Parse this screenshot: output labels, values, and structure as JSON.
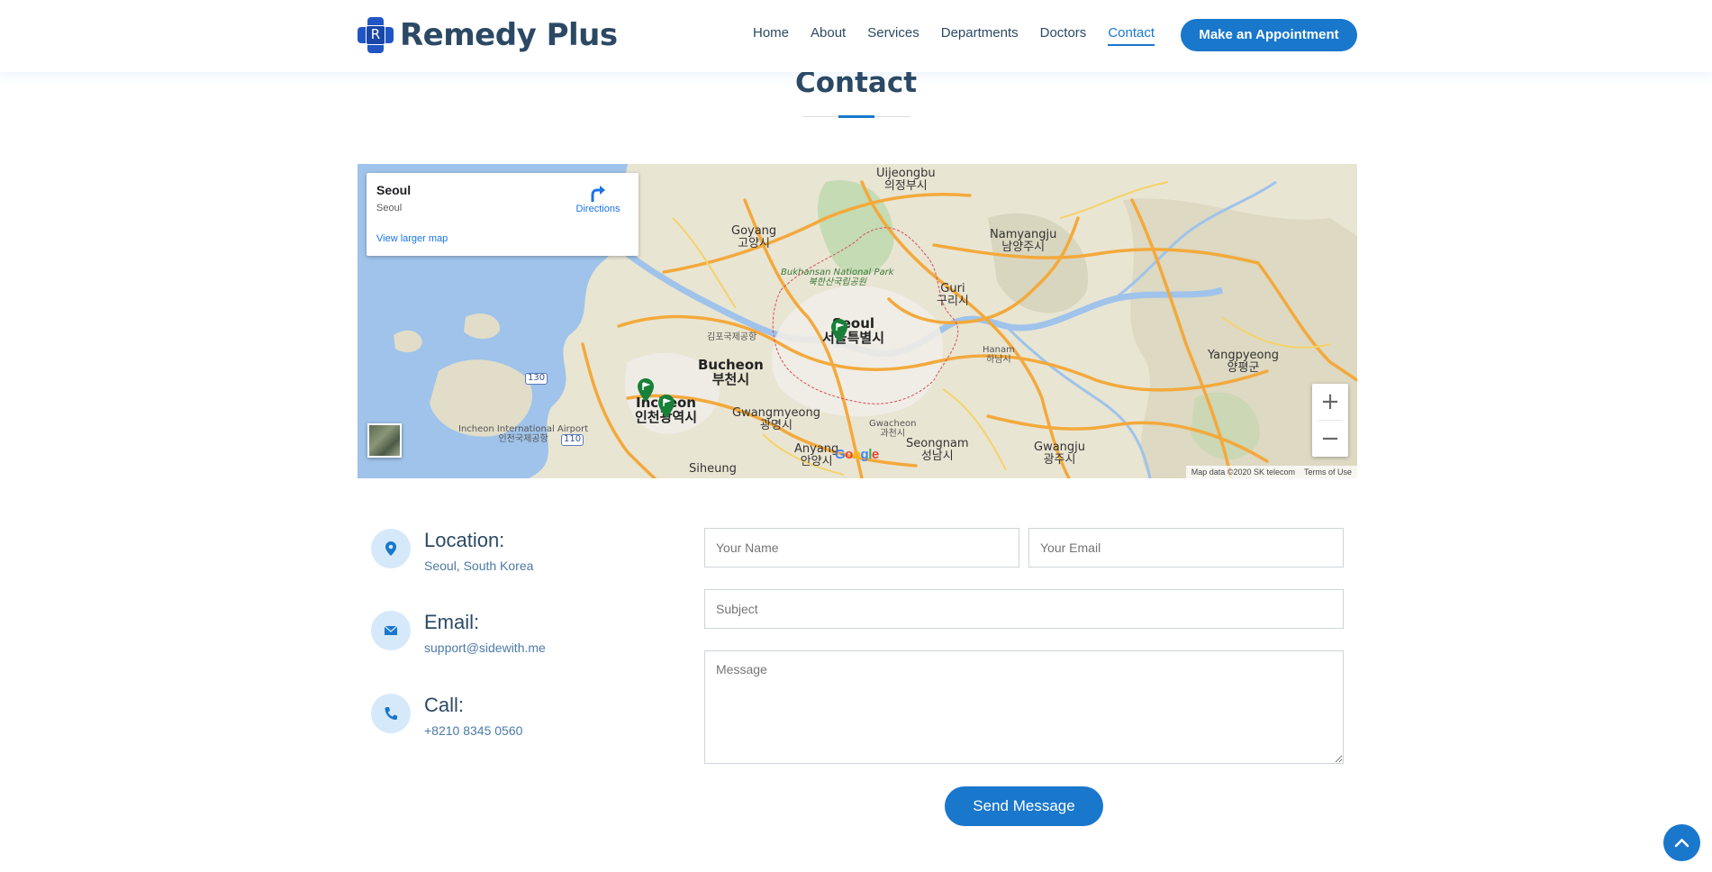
{
  "header": {
    "logo_letter": "R",
    "brand": "Remedy Plus",
    "nav": [
      {
        "label": "Home"
      },
      {
        "label": "About"
      },
      {
        "label": "Services"
      },
      {
        "label": "Departments"
      },
      {
        "label": "Doctors"
      },
      {
        "label": "Contact",
        "active": true
      }
    ],
    "cta_label": "Make an Appointment"
  },
  "section": {
    "title": "Contact"
  },
  "map": {
    "place_title": "Seoul",
    "place_subtitle": "Seoul",
    "directions_label": "Directions",
    "larger_map_label": "View larger map",
    "zoom_in": "+",
    "zoom_out": "−",
    "attribution": "Map data ©2020 SK telecom",
    "terms": "Terms of Use",
    "google_logo": "Google",
    "labels": {
      "uijeongbu_en": "Uijeongbu",
      "uijeongbu_ko": "의정부시",
      "goyang_en": "Goyang",
      "goyang_ko": "고양시",
      "namyangju_en": "Namyangju",
      "namyangju_ko": "남양주시",
      "bukhansan_en": "Bukhansan National Park",
      "bukhansan_ko": "북한산국립공원",
      "guri_en": "Guri",
      "guri_ko": "구리시",
      "seoul_en": "Seoul",
      "seoul_ko": "서울특별시",
      "gimpo_ko": "김포국제공항",
      "hanam_en": "Hanam",
      "hanam_ko": "하남시",
      "yangpyeong_en": "Yangpyeong",
      "yangpyeong_ko": "양평군",
      "bucheon_en": "Bucheon",
      "bucheon_ko": "부천시",
      "incheon_en": "Incheon",
      "incheon_ko": "인천광역시",
      "gwangmyeong_en": "Gwangmyeong",
      "gwangmyeong_ko": "광명시",
      "gwacheon_en": "Gwacheon",
      "gwacheon_ko": "과천시",
      "airport_en": "Incheon International Airport",
      "airport_ko": "인천국제공항",
      "anyang_en": "Anyang",
      "anyang_ko": "안양시",
      "seongnam_en": "Seongnam",
      "seongnam_ko": "성남시",
      "gwangju_en": "Gwangju",
      "gwangju_ko": "광주시",
      "siheung_en": "Siheung",
      "route_130": "130",
      "route_110": "110"
    }
  },
  "contact_info": [
    {
      "heading": "Location:",
      "value": "Seoul, South Korea",
      "icon": "map-pin-icon"
    },
    {
      "heading": "Email:",
      "value": "support@sidewith.me",
      "icon": "envelope-icon"
    },
    {
      "heading": "Call:",
      "value": "+8210 8345 0560",
      "icon": "phone-icon"
    }
  ],
  "form": {
    "name_placeholder": "Your Name",
    "email_placeholder": "Your Email",
    "subject_placeholder": "Subject",
    "message_placeholder": "Message",
    "submit_label": "Send Message"
  },
  "colors": {
    "primary": "#1977cc",
    "heading": "#2c4964",
    "icon_bg": "#d6e9fa"
  }
}
